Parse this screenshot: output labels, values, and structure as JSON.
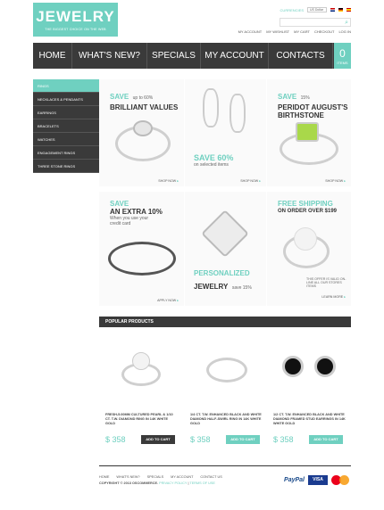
{
  "logo": {
    "title": "JEWELRY",
    "tagline": "THE BIGGEST CHOICE ON THE WEB"
  },
  "topbar": {
    "currencies_label": "CURRENCIES",
    "currency": "US Dollar"
  },
  "toplinks": [
    "MY ACCOUNT",
    "MY WISHLIST",
    "MY CART",
    "CHECKOUT",
    "LOG IN"
  ],
  "nav": {
    "items": [
      "HOME",
      "WHAT'S NEW?",
      "SPECIALS",
      "MY ACCOUNT",
      "CONTACTS"
    ],
    "cart_count": "0",
    "cart_label": "ITEMS"
  },
  "sidebar": [
    "RINGS",
    "NECKLACES & PENDANTS",
    "EARRINGS",
    "BRACELETS",
    "WATCHES",
    "ENGAGEMENT RINGS",
    "THREE STONE RINGS"
  ],
  "tiles": {
    "t1": {
      "h1": "SAVE",
      "h1b": "up to 60%",
      "h2": "BRILLIANT VALUES",
      "link": "SHOP NOW"
    },
    "t2": {
      "h1": "SAVE 60%",
      "sm": "on selected items",
      "link": "SHOP NOW"
    },
    "t3": {
      "h1": "SAVE",
      "h1b": "15%",
      "h2": "PERIDOT AUGUST'S",
      "h3": "BIRTHSTONE",
      "link": "SHOP NOW"
    },
    "t4": {
      "h1": "SAVE",
      "h2": "AN EXTRA 10%",
      "sm": "When you use your credit card",
      "link": "APPLY NOW"
    },
    "t5": {
      "h1": "PERSONALIZED",
      "h2": "JEWELRY",
      "h2b": "save 15%"
    },
    "t6": {
      "h1": "FREE SHIPPING",
      "h2": "ON ORDER OVER $199",
      "sm": "THIS OFFER IS VALID ON-LINE ALL OUR STORES ITEMS",
      "link": "LEARN MORE"
    }
  },
  "popular": {
    "title": "POPULAR PRODUCTS",
    "products": [
      {
        "desc": "FRESH-5.00MM CULTURED PEARL & 1/10 CT. T.W. DIAMOND RING IN 14K WHITE GOLD",
        "price": "$ 358",
        "btn": "ADD TO CART"
      },
      {
        "desc": "1/4 CT. T.W. ENHANCED BLACK AND WHITE DIAMOND HALF-SWIRL RING IN 14K WHITE GOLD",
        "price": "$ 358",
        "btn": "ADD TO CART"
      },
      {
        "desc": "1/2 CT. T.W. ENHANCED BLACK AND WHITE DIAMOND FRAMED STUD EARRINGS IN 14K WHITE GOLD",
        "price": "$ 358",
        "btn": "ADD TO CART"
      }
    ]
  },
  "footer": {
    "links": [
      "HOME",
      "WHAT'S NEW?",
      "SPECIALS",
      "MY ACCOUNT",
      "CONTACT US"
    ],
    "copyright": "COPYRIGHT © 2013 OSCOMMERCE.",
    "privacy": "PRIVACY POLICY",
    "terms": "TERMS OF USE",
    "paypal": "PayPal",
    "visa": "VISA"
  },
  "colors": {
    "accent": "#6fd0c0",
    "dark": "#3a3a3a"
  }
}
